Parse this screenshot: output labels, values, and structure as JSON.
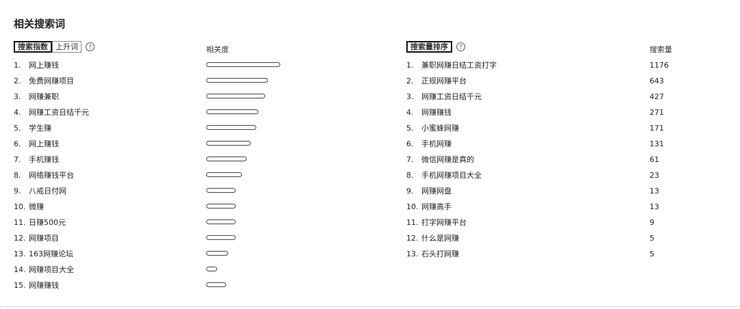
{
  "title": "相关搜索词",
  "left": {
    "tabs": [
      {
        "label": "搜索指数",
        "active": true
      },
      {
        "label": "上升词",
        "active": false
      }
    ],
    "col_label": "相关度",
    "rows": [
      {
        "rank": "1.",
        "keyword": "网上赚钱",
        "relevance": 1.0
      },
      {
        "rank": "2.",
        "keyword": "免费网赚项目",
        "relevance": 0.83
      },
      {
        "rank": "3.",
        "keyword": "网赚兼职",
        "relevance": 0.8
      },
      {
        "rank": "4.",
        "keyword": "网赚工资日结千元",
        "relevance": 0.7
      },
      {
        "rank": "5.",
        "keyword": "学生赚",
        "relevance": 0.68
      },
      {
        "rank": "6.",
        "keyword": "网上赚钱",
        "relevance": 0.6
      },
      {
        "rank": "7.",
        "keyword": "手机赚钱",
        "relevance": 0.55
      },
      {
        "rank": "8.",
        "keyword": "网络赚钱平台",
        "relevance": 0.48
      },
      {
        "rank": "9.",
        "keyword": "八戒日付网",
        "relevance": 0.4
      },
      {
        "rank": "10.",
        "keyword": "微赚",
        "relevance": 0.4
      },
      {
        "rank": "11.",
        "keyword": "日赚500元",
        "relevance": 0.4
      },
      {
        "rank": "12.",
        "keyword": "网赚项目",
        "relevance": 0.4
      },
      {
        "rank": "13.",
        "keyword": "163网赚论坛",
        "relevance": 0.3
      },
      {
        "rank": "14.",
        "keyword": "网赚项目大全",
        "relevance": 0.15
      },
      {
        "rank": "15.",
        "keyword": "网赚赚钱",
        "relevance": 0.27
      }
    ]
  },
  "right": {
    "tabs": [
      {
        "label": "搜索量排序",
        "active": true
      }
    ],
    "col_label": "搜索量",
    "rows": [
      {
        "rank": "1.",
        "keyword": "兼职网赚日结工资打字",
        "count": "1176"
      },
      {
        "rank": "2.",
        "keyword": "正规网赚平台",
        "count": "643"
      },
      {
        "rank": "3.",
        "keyword": "网赚工资日结千元",
        "count": "427"
      },
      {
        "rank": "4.",
        "keyword": "网赚赚钱",
        "count": "271"
      },
      {
        "rank": "5.",
        "keyword": "小蜜蜂网赚",
        "count": "171"
      },
      {
        "rank": "6.",
        "keyword": "手机网赚",
        "count": "131"
      },
      {
        "rank": "7.",
        "keyword": "微信网赚是真的",
        "count": "61"
      },
      {
        "rank": "8.",
        "keyword": "手机网赚项目大全",
        "count": "23"
      },
      {
        "rank": "9.",
        "keyword": "网赚网盘",
        "count": "13"
      },
      {
        "rank": "10.",
        "keyword": "网赚高手",
        "count": "13"
      },
      {
        "rank": "11.",
        "keyword": "打字网赚平台",
        "count": "9"
      },
      {
        "rank": "12.",
        "keyword": "什么是网赚",
        "count": "5"
      },
      {
        "rank": "13.",
        "keyword": "石头打网赚",
        "count": "5"
      }
    ]
  },
  "help_icon": "question-circle-icon",
  "help_glyph": "?"
}
